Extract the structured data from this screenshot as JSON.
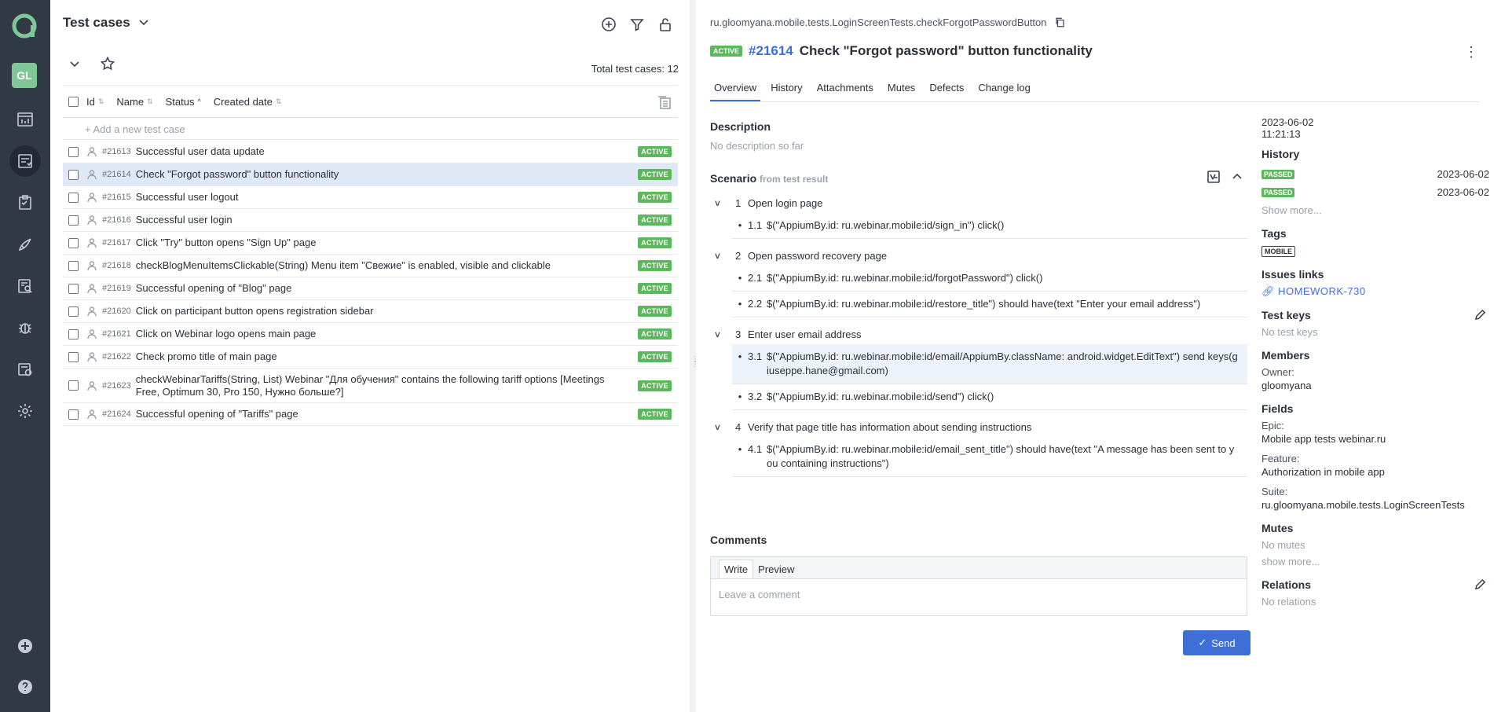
{
  "sidebar": {
    "avatar_initials": "GL",
    "icons": [
      "dashboard-icon",
      "test-cases-icon",
      "test-plans-icon",
      "launches-icon",
      "analytics-icon",
      "defects-icon",
      "jobs-icon",
      "settings-icon",
      "add-icon",
      "help-icon"
    ]
  },
  "left": {
    "title": "Test cases",
    "total_label": "Total test cases: 12",
    "columns": {
      "id": "Id",
      "name": "Name",
      "status": "Status",
      "created": "Created date"
    },
    "add_placeholder": "+ Add a new test case",
    "rows": [
      {
        "id": "#21613",
        "name": "Successful user data update",
        "status": "ACTIVE"
      },
      {
        "id": "#21614",
        "name": "Check \"Forgot password\" button functionality",
        "status": "ACTIVE"
      },
      {
        "id": "#21615",
        "name": "Successful user logout",
        "status": "ACTIVE"
      },
      {
        "id": "#21616",
        "name": "Successful user login",
        "status": "ACTIVE"
      },
      {
        "id": "#21617",
        "name": "Click \"Try\" button opens \"Sign Up\" page",
        "status": "ACTIVE"
      },
      {
        "id": "#21618",
        "name": "checkBlogMenuItemsClickable(String) Menu item \"Свежие\" is enabled, visible and clickable",
        "status": "ACTIVE"
      },
      {
        "id": "#21619",
        "name": "Successful opening of \"Blog\" page",
        "status": "ACTIVE"
      },
      {
        "id": "#21620",
        "name": "Click on participant button opens registration sidebar",
        "status": "ACTIVE"
      },
      {
        "id": "#21621",
        "name": "Click on Webinar logo opens main page",
        "status": "ACTIVE"
      },
      {
        "id": "#21622",
        "name": "Check promo title of main page",
        "status": "ACTIVE"
      },
      {
        "id": "#21623",
        "name": "checkWebinarTariffs(String, List) Webinar \"Для обучения\" contains the following tariff options [Meetings Free, Optimum 30, Pro 150, Нужно больше?]",
        "status": "ACTIVE"
      },
      {
        "id": "#21624",
        "name": "Successful opening of \"Tariffs\" page",
        "status": "ACTIVE"
      }
    ]
  },
  "detail": {
    "path": "ru.gloomyana.mobile.tests.LoginScreenTests.checkForgotPasswordButton",
    "status": "ACTIVE",
    "id": "#21614",
    "title": "Check \"Forgot password\" button functionality",
    "tabs": [
      "Overview",
      "History",
      "Attachments",
      "Mutes",
      "Defects",
      "Change log"
    ],
    "description_heading": "Description",
    "description_text": "No description so far",
    "scenario_heading": "Scenario",
    "scenario_source": "from test result",
    "steps": [
      {
        "n": "1",
        "title": "Open login page",
        "subs": [
          {
            "n": "1.1",
            "text": "$(\"AppiumBy.id: ru.webinar.mobile:id/sign_in\") click()"
          }
        ]
      },
      {
        "n": "2",
        "title": "Open password recovery page",
        "subs": [
          {
            "n": "2.1",
            "text": "$(\"AppiumBy.id: ru.webinar.mobile:id/forgotPassword\") click()"
          },
          {
            "n": "2.2",
            "text": "$(\"AppiumBy.id: ru.webinar.mobile:id/restore_title\") should have(text \"Enter your email address\")"
          }
        ]
      },
      {
        "n": "3",
        "title": "Enter user email address",
        "subs": [
          {
            "n": "3.1",
            "text": "$(\"AppiumBy.id: ru.webinar.mobile:id/email/AppiumBy.className: android.widget.EditText\") send keys(giuseppe.hane@gmail.com)"
          },
          {
            "n": "3.2",
            "text": "$(\"AppiumBy.id: ru.webinar.mobile:id/send\") click()"
          }
        ]
      },
      {
        "n": "4",
        "title": "Verify that page title has information about sending instructions",
        "subs": [
          {
            "n": "4.1",
            "text": "$(\"AppiumBy.id: ru.webinar.mobile:id/email_sent_title\") should have(text \"A message has been sent to you containing instructions\")"
          }
        ]
      }
    ],
    "comments_heading": "Comments",
    "comment_tabs": {
      "write": "Write",
      "preview": "Preview"
    },
    "comment_placeholder": "Leave a comment",
    "send_label": "Send"
  },
  "info": {
    "created_date": "2023-06-02",
    "created_time": "11:21:13",
    "history_heading": "History",
    "history": [
      {
        "status": "PASSED",
        "date": "2023-06-02"
      },
      {
        "status": "PASSED",
        "date": "2023-06-02"
      }
    ],
    "show_more": "Show more...",
    "tags_heading": "Tags",
    "tag": "MOBILE",
    "issues_heading": "Issues links",
    "issue": "HOMEWORK-730",
    "test_keys_heading": "Test keys",
    "test_keys_text": "No test keys",
    "members_heading": "Members",
    "owner_label": "Owner:",
    "owner": "gloomyana",
    "fields_heading": "Fields",
    "epic_label": "Epic:",
    "epic": "Mobile app tests webinar.ru",
    "feature_label": "Feature:",
    "feature": "Authorization in mobile app",
    "suite_label": "Suite:",
    "suite": "ru.gloomyana.mobile.tests.LoginScreenTests",
    "mutes_heading": "Mutes",
    "mutes_text": "No mutes",
    "mutes_more": "show more...",
    "relations_heading": "Relations",
    "relations_text": "No relations"
  }
}
